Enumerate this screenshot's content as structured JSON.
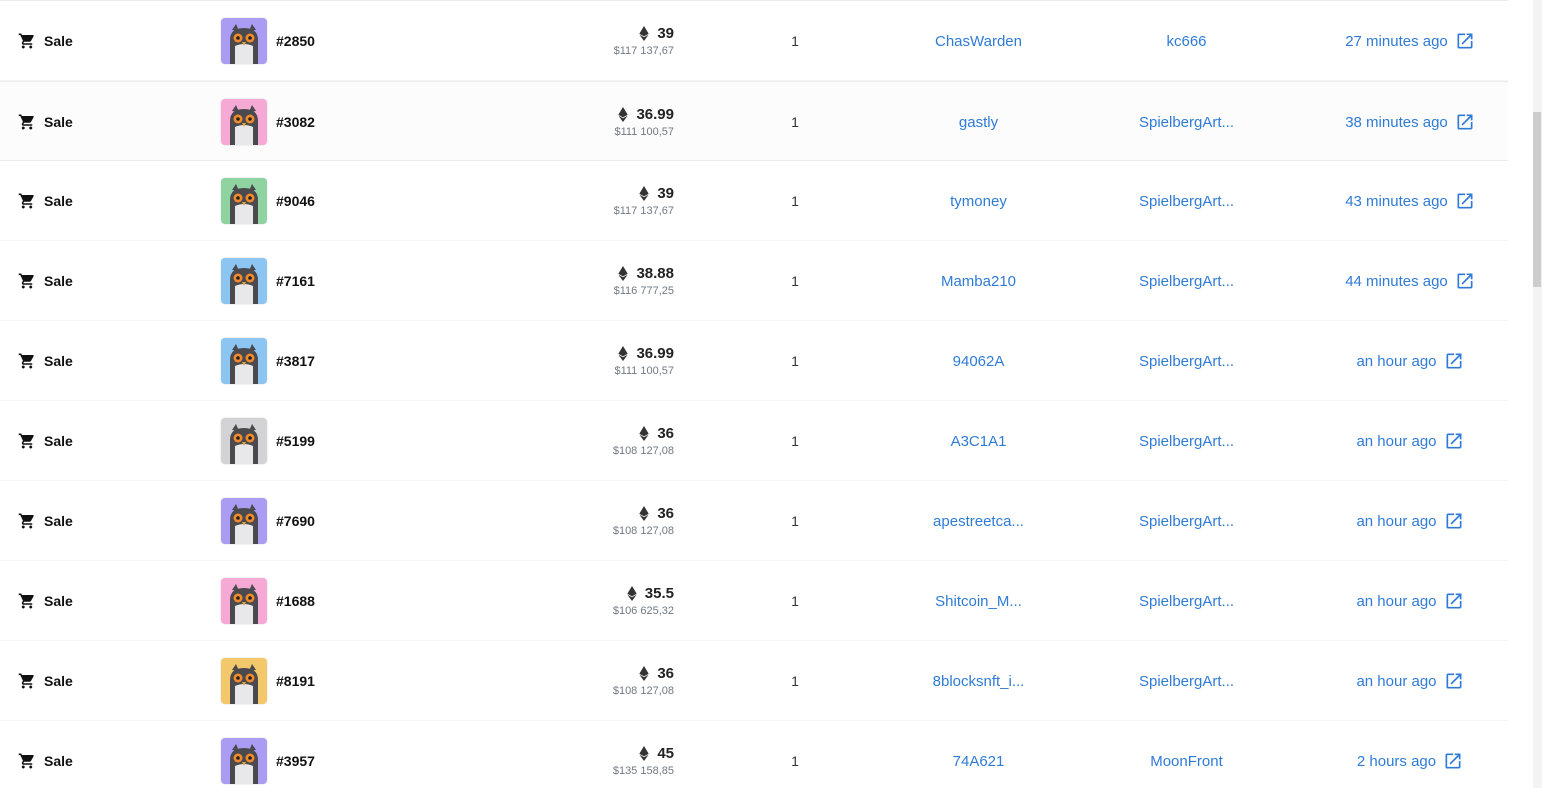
{
  "colors": {
    "link": "#2f7bd6",
    "text": "#111111",
    "muted": "#707a83"
  },
  "icons": {
    "event": "cart-icon",
    "currency": "ethereum-icon",
    "link": "external-link-icon"
  },
  "rows": [
    {
      "event": "Sale",
      "item_id": "#2850",
      "avatar_bg": "#a99cf2",
      "eth": "39",
      "usd": "$117 137,67",
      "quantity": "1",
      "from": "ChasWarden",
      "to": "kc666",
      "time": "27 minutes ago"
    },
    {
      "event": "Sale",
      "item_id": "#3082",
      "avatar_bg": "#f7a9d5",
      "eth": "36.99",
      "usd": "$111 100,57",
      "quantity": "1",
      "from": "gastly",
      "to": "SpielbergArt...",
      "time": "38 minutes ago"
    },
    {
      "event": "Sale",
      "item_id": "#9046",
      "avatar_bg": "#8fd3a0",
      "eth": "39",
      "usd": "$117 137,67",
      "quantity": "1",
      "from": "tymoney",
      "to": "SpielbergArt...",
      "time": "43 minutes ago"
    },
    {
      "event": "Sale",
      "item_id": "#7161",
      "avatar_bg": "#8cc4f2",
      "eth": "38.88",
      "usd": "$116 777,25",
      "quantity": "1",
      "from": "Mamba210",
      "to": "SpielbergArt...",
      "time": "44 minutes ago"
    },
    {
      "event": "Sale",
      "item_id": "#3817",
      "avatar_bg": "#8cc4f2",
      "eth": "36.99",
      "usd": "$111 100,57",
      "quantity": "1",
      "from": "94062A",
      "to": "SpielbergArt...",
      "time": "an hour ago"
    },
    {
      "event": "Sale",
      "item_id": "#5199",
      "avatar_bg": "#d3d3d6",
      "eth": "36",
      "usd": "$108 127,08",
      "quantity": "1",
      "from": "A3C1A1",
      "to": "SpielbergArt...",
      "time": "an hour ago"
    },
    {
      "event": "Sale",
      "item_id": "#7690",
      "avatar_bg": "#a99cf2",
      "eth": "36",
      "usd": "$108 127,08",
      "quantity": "1",
      "from": "apestreetca...",
      "to": "SpielbergArt...",
      "time": "an hour ago"
    },
    {
      "event": "Sale",
      "item_id": "#1688",
      "avatar_bg": "#f7a9d5",
      "eth": "35.5",
      "usd": "$106 625,32",
      "quantity": "1",
      "from": "Shitcoin_M...",
      "to": "SpielbergArt...",
      "time": "an hour ago"
    },
    {
      "event": "Sale",
      "item_id": "#8191",
      "avatar_bg": "#f2c86a",
      "eth": "36",
      "usd": "$108 127,08",
      "quantity": "1",
      "from": "8blocksnft_i...",
      "to": "SpielbergArt...",
      "time": "an hour ago"
    },
    {
      "event": "Sale",
      "item_id": "#3957",
      "avatar_bg": "#a99cf2",
      "eth": "45",
      "usd": "$135 158,85",
      "quantity": "1",
      "from": "74A621",
      "to": "MoonFront",
      "time": "2 hours ago"
    }
  ]
}
